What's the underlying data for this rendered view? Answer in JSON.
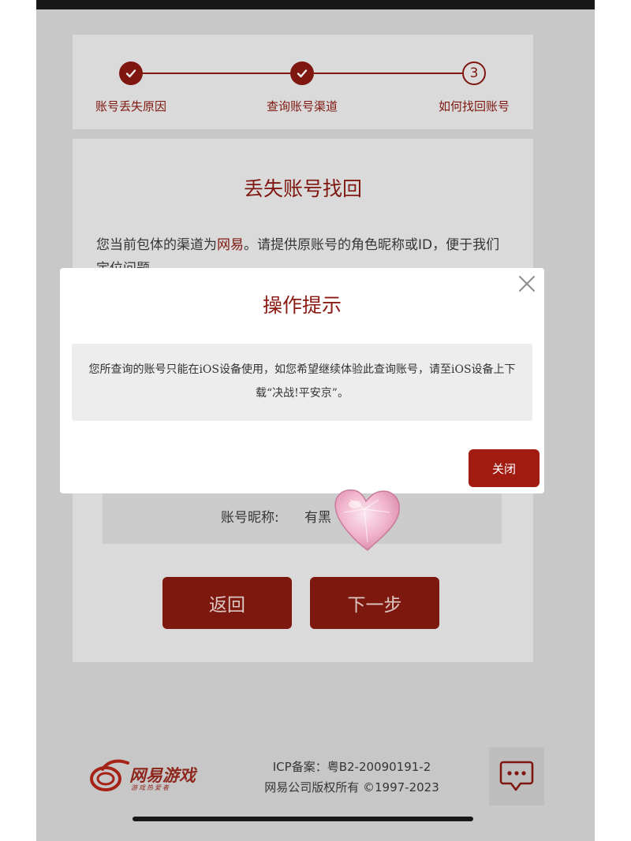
{
  "steps": {
    "items": [
      {
        "label": "账号丢失原因",
        "state": "done"
      },
      {
        "label": "查询账号渠道",
        "state": "done"
      },
      {
        "label": "如何找回账号",
        "state": "current",
        "number": "3"
      }
    ]
  },
  "main": {
    "title": "丢失账号找回",
    "desc_prefix": "您当前包体的渠道为",
    "desc_channel": "网易",
    "desc_suffix": "。请提供原账号的角色昵称或ID，便于我们定位问题",
    "nickname_label": "账号昵称:",
    "nickname_value": "有黑",
    "back_label": "返回",
    "next_label": "下一步"
  },
  "modal": {
    "title": "操作提示",
    "message": "您所查询的账号只能在iOS设备使用，如您希望继续体验此查询账号，请至iOS设备上下载“决战!平安京”。",
    "close_label": "关闭"
  },
  "footer": {
    "logo_text": "网易游戏",
    "logo_sub": "游戏热爱者",
    "icp": "ICP备案：粤B2-20090191-2",
    "copyright": "网易公司版权所有 ©1997-2023"
  },
  "colors": {
    "brand": "#8a1a12",
    "button": "#a11b10"
  }
}
